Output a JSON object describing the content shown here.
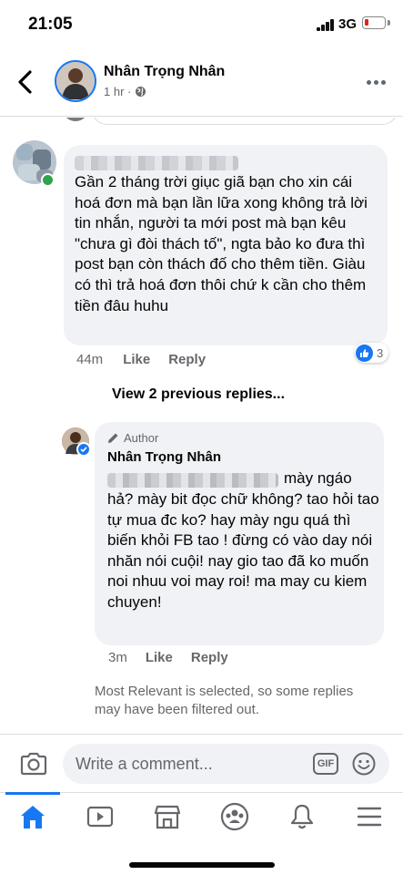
{
  "status_bar": {
    "time": "21:05",
    "network": "3G"
  },
  "header": {
    "name": "Nhân Trọng Nhân",
    "time": "1 hr ·"
  },
  "comment": {
    "text": "Gần 2 tháng trời giục giã bạn cho xin cái hoá đơn mà bạn lần lữa xong không trả lời tin nhắn, người ta mới post mà bạn kêu \"chưa gì đòi thách tố\", ngta bảo ko đưa thì post bạn còn thách đố cho thêm tiền. Giàu có thì trả hoá đơn thôi chứ k cần cho thêm tiền đâu huhu",
    "reaction_count": "3",
    "time": "44m",
    "like": "Like",
    "reply": "Reply"
  },
  "view_previous": "View 2 previous replies...",
  "reply": {
    "badge": "Author",
    "name": "Nhân Trọng Nhân",
    "first_words": "mày ngáo",
    "text": "hả? mày bit đọc chữ không? tao hỏi tao tự mua đc ko? hay mày ngu quá thì biến khỏi FB tao ! đừng có vào day nói nhăn nói cuội! nay gio tao đã ko muốn noi nhuu voi may roi! ma may cu kiem chuyen!",
    "time": "3m",
    "like": "Like",
    "reply": "Reply"
  },
  "filter_note": "Most Relevant is selected, so some replies may have been filtered out.",
  "composer": {
    "placeholder": "Write a comment...",
    "gif": "GIF"
  },
  "tabs": [
    "home-icon",
    "watch-icon",
    "marketplace-icon",
    "groups-icon",
    "notifications-icon",
    "menu-icon"
  ],
  "colors": {
    "accent": "#1877f2",
    "bubble": "#f0f2f5",
    "secondary_text": "#65676b",
    "online": "#31a24c"
  }
}
